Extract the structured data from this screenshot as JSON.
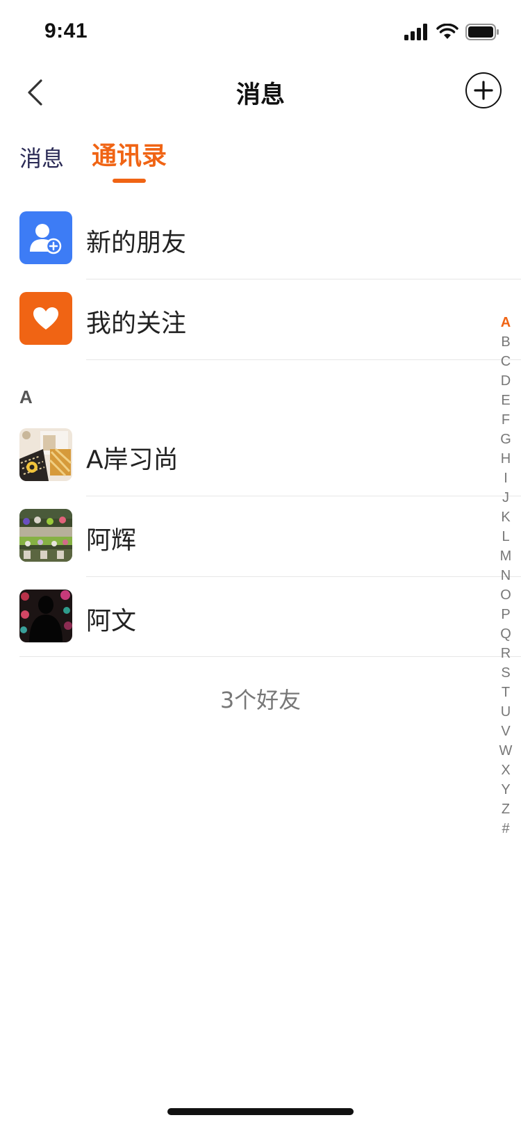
{
  "status_bar": {
    "time": "9:41"
  },
  "nav": {
    "title": "消息",
    "back_icon": "chevron-left-icon",
    "add_icon": "plus-circle-icon"
  },
  "tabs": [
    {
      "label": "消息",
      "active": false
    },
    {
      "label": "通讯录",
      "active": true
    }
  ],
  "quick_entries": [
    {
      "label": "新的朋友",
      "icon": "add-user-icon",
      "color": "#3d7cf5"
    },
    {
      "label": "我的关注",
      "icon": "heart-icon",
      "color": "#f06414"
    }
  ],
  "sections": [
    {
      "letter": "A",
      "contacts": [
        {
          "name": "A岸习尚",
          "avatar": "avatar-photo-crafts"
        },
        {
          "name": "阿辉",
          "avatar": "avatar-photo-market"
        },
        {
          "name": "阿文",
          "avatar": "avatar-photo-silhouette"
        }
      ]
    }
  ],
  "friend_count": "3个好友",
  "index": {
    "letters": [
      "A",
      "B",
      "C",
      "D",
      "E",
      "F",
      "G",
      "H",
      "I",
      "J",
      "K",
      "L",
      "M",
      "N",
      "O",
      "P",
      "Q",
      "R",
      "S",
      "T",
      "U",
      "V",
      "W",
      "X",
      "Y",
      "Z",
      "#"
    ],
    "active": "A"
  },
  "colors": {
    "accent": "#f06414",
    "blue": "#3d7cf5",
    "tab_inactive": "#2a2a55"
  }
}
